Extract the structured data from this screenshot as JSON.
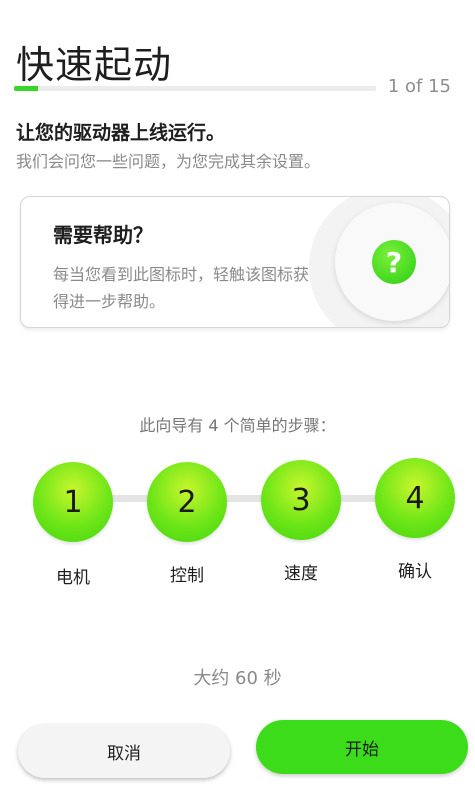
{
  "header": {
    "title": "快速起动",
    "progress_text": "1 of 15",
    "progress_fraction": 0.0667
  },
  "intro": {
    "headline": "让您的驱动器上线运行。",
    "subhead": "我们会问您一些问题，为您完成其余设置。"
  },
  "help_card": {
    "title": "需要帮助？",
    "text": "每当您看到此图标时，轻触该图标获得进一步帮助。",
    "icon_glyph": "?",
    "icon": "question-mark-icon"
  },
  "steps": {
    "caption": "此向导有 4 个简单的步骤：",
    "items": [
      {
        "number": "1",
        "label": "电机"
      },
      {
        "number": "2",
        "label": "控制"
      },
      {
        "number": "3",
        "label": "速度"
      },
      {
        "number": "4",
        "label": "确认"
      }
    ]
  },
  "duration": "大约 60 秒",
  "buttons": {
    "cancel": "取消",
    "start": "开始"
  },
  "colors": {
    "accent": "#3ddc1a",
    "progress": "#39d629"
  }
}
